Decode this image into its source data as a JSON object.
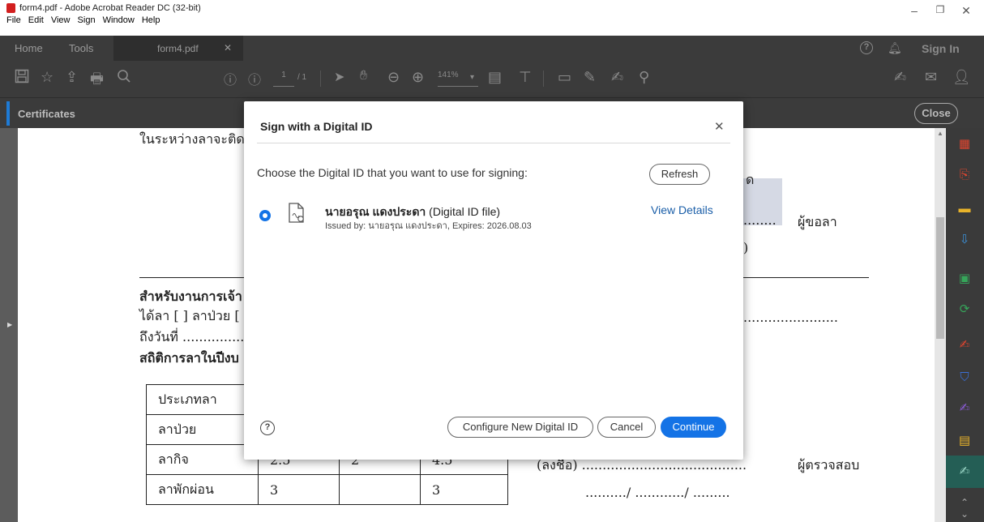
{
  "window": {
    "title": "form4.pdf - Adobe Acrobat Reader DC (32-bit)",
    "menus": [
      "File",
      "Edit",
      "View",
      "Sign",
      "Window",
      "Help"
    ]
  },
  "tabs": {
    "home": "Home",
    "tools": "Tools",
    "document": "form4.pdf",
    "sign_in": "Sign In"
  },
  "toolbar": {
    "page_current": "1",
    "page_total": "/ 1",
    "zoom": "141%"
  },
  "panel": {
    "title": "Certificates",
    "close_label": "Close"
  },
  "page": {
    "line1": "ในระหว่างลาจะติด",
    "text_right1": "ด",
    "signer_label": "ผู้ขอลา",
    "paren": ")",
    "section_heading": "สำหรับงานการเจ้า",
    "leave_line": "ได้ลา [ ] ลาป่วย [",
    "date_line": "ถึงวันที่ ...............",
    "stats_heading": "สถิติการลาในปีงบ",
    "table_rows": [
      {
        "type": "ประเภทลา",
        "a": "",
        "b": "",
        "c": ""
      },
      {
        "type": "ลาป่วย",
        "a": "",
        "b": "",
        "c": ""
      },
      {
        "type": "ลากิจ",
        "a": "2.5",
        "b": "2",
        "c": "4.5"
      },
      {
        "type": "ลาพักผ่อน",
        "a": "3",
        "b": "",
        "c": "3"
      }
    ],
    "sign_line": "(ลงชื่อ) ........................................",
    "checker_label": "ผู้ตรวจสอบ",
    "date_bottom": "........../ ............/ .........",
    "dots_right": "......................."
  },
  "dialog": {
    "title": "Sign with a Digital ID",
    "prompt": "Choose the Digital ID that you want to use for signing:",
    "refresh_label": "Refresh",
    "id_name": "นายอรุณ แดงประดา",
    "id_type": "(Digital ID file)",
    "id_issued": "Issued by: นายอรุณ แดงประดา, Expires: 2026.08.03",
    "view_details": "View Details",
    "configure_label": "Configure New Digital ID",
    "cancel_label": "Cancel",
    "continue_label": "Continue"
  },
  "colors": {
    "accent": "#1473e6",
    "dark_chrome": "#3b3b3b",
    "link": "#1a5ea8"
  }
}
